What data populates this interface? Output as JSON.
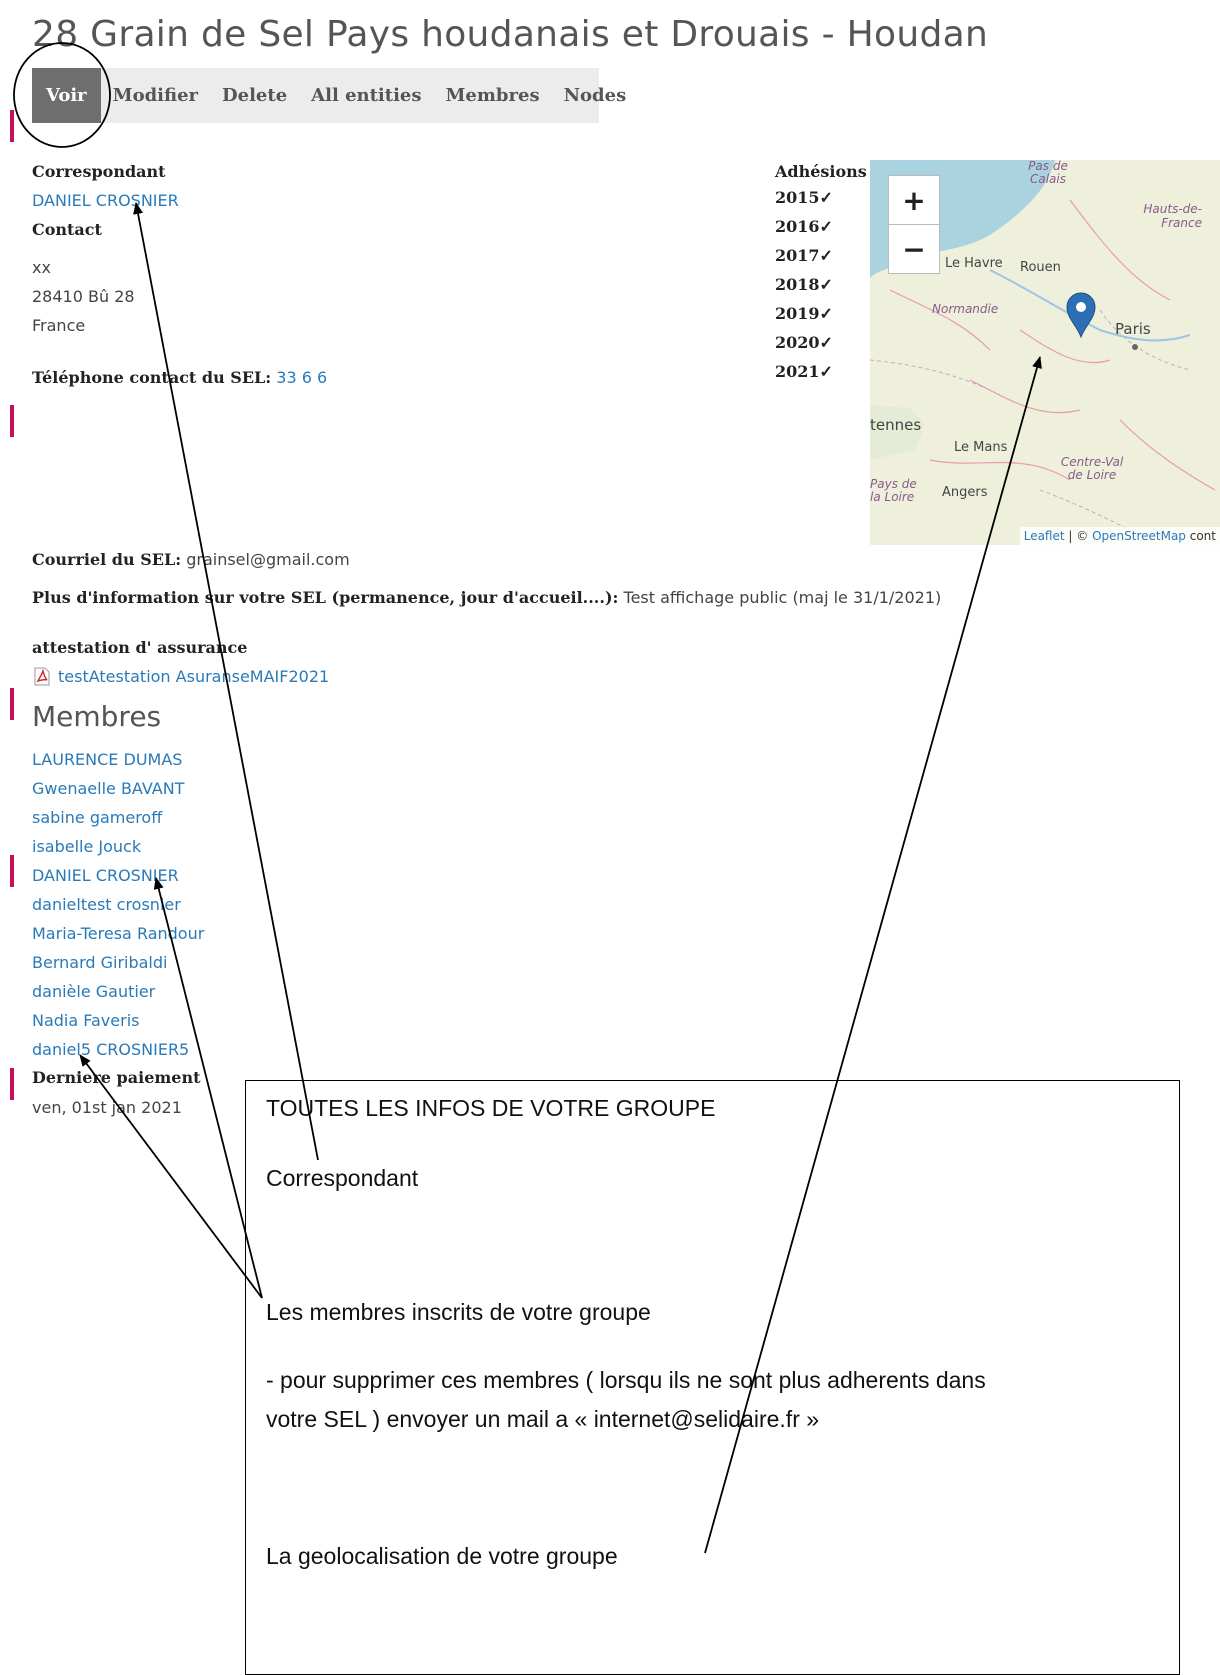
{
  "page_title": "28 Grain de Sel Pays houdanais et Drouais - Houdan",
  "tabs": [
    "Voir",
    "Modifier",
    "Delete",
    "All entities",
    "Membres",
    "Nodes"
  ],
  "correspondant": {
    "label": "Correspondant",
    "name": "DANIEL CROSNIER"
  },
  "contact": {
    "label": "Contact",
    "lines": [
      "xx",
      "28410 Bû 28",
      "France"
    ]
  },
  "telephone": {
    "label": "Téléphone contact du SEL:",
    "value": "33 6 6"
  },
  "adhesions": {
    "label": "Adhésions",
    "years": [
      "2015✓",
      "2016✓",
      "2017✓",
      "2018✓",
      "2019✓",
      "2020✓",
      "2021✓"
    ]
  },
  "map": {
    "zoom_in": "+",
    "zoom_out": "−",
    "labels": {
      "pas_de_calais": "Pas de Calais",
      "hauts_de_france": "Hauts-de-France",
      "le_havre": "Le Havre",
      "rouen": "Rouen",
      "normandie": "Normandie",
      "paris": "Paris",
      "rennes": "tennes",
      "le_mans": "Le Mans",
      "centre_val_de_loire": "Centre-Val de Loire",
      "pays_de_la_loire": "Pays de la Loire",
      "angers": "Angers"
    },
    "attribution_leaflet": "Leaflet",
    "attribution_sep": " | © ",
    "attribution_osm": "OpenStreetMap",
    "attribution_rest": " cont",
    "marker_icon": "map-marker-icon",
    "colors": {
      "marker": "#2d6fb5",
      "water": "#aad3df",
      "land": "#eef0dc"
    }
  },
  "courriel": {
    "label": "Courriel du SEL:",
    "value": "grainsel@gmail.com"
  },
  "plus_info": {
    "label": "Plus d'information sur votre SEL (permanence, jour d'accueil....):",
    "value": "Test affichage public (maj le 31/1/2021)"
  },
  "attestation": {
    "label": "attestation d' assurance",
    "file_name": "testAtestation AsuranseMAIF2021",
    "file_icon": "pdf-file-icon"
  },
  "membres": {
    "heading": "Membres",
    "list": [
      "LAURENCE DUMAS",
      "Gwenaelle BAVANT",
      "sabine gameroff",
      "isabelle Jouck",
      "DANIEL CROSNIER",
      "danieltest crosnier",
      "Maria-Teresa Randour",
      "Bernard Giribaldi",
      "danièle Gautier",
      "Nadia Faveris",
      "daniel5 CROSNIER5"
    ]
  },
  "derniere_paiement": {
    "label": "Derniere paiement",
    "value": "ven, 01st jan 2021"
  },
  "annotation": {
    "title": "TOUTES LES INFOS DE VOTRE GROUPE",
    "correspondant": "Correspondant",
    "membres": "Les membres inscrits de votre groupe",
    "supprimer_line1": "- pour supprimer ces membres ( lorsqu ils ne sont plus adherents dans",
    "supprimer_line2": "votre SEL ) envoyer un mail a « internet@selidaire.fr »",
    "geoloc": "La geolocalisation de votre groupe"
  },
  "colors": {
    "link": "#2a7ab8",
    "active_tab": "#6e6e6e",
    "tab_bar": "#ececec",
    "side_accent": "#c8105a"
  }
}
